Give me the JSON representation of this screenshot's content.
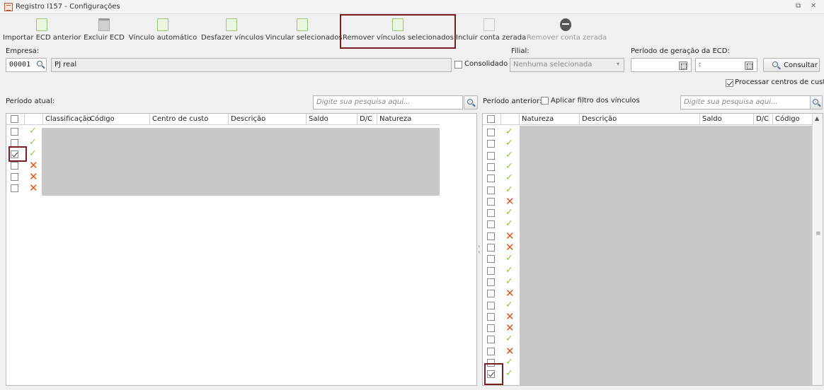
{
  "window": {
    "title": "Registro I157 - Configurações",
    "restore_glyph": "⧉",
    "close_glyph": "✕"
  },
  "toolbar": {
    "import_label": "Importar ECD anterior",
    "delete_label": "Excluir ECD",
    "auto_link_label": "Vínculo automático",
    "undo_links_label": "Desfazer vínculos",
    "link_selected_label": "Vincular selecionados",
    "remove_links_label": "Remover vínculos selecionados",
    "include_zero_label": "Incluir conta zerada",
    "remove_zero_label": "Remover conta zerada"
  },
  "filters": {
    "empresa_label": "Empresa:",
    "empresa_code": "00001",
    "empresa_name": "PJ real",
    "consolidado_label": "Consolidado",
    "filial_label": "Filial:",
    "filial_value": "Nenhuma selecionada",
    "periodo_label": "Período de geração da ECD:",
    "periodo_sep": ":",
    "consultar_label": "Consultar",
    "processar_label": "Processar centros de custo"
  },
  "left": {
    "title": "Período atual:",
    "search_placeholder": "Digite sua pesquisa aqui...",
    "columns": [
      "Classificação",
      "Código",
      "Centro de custo",
      "Descrição",
      "Saldo",
      "D/C",
      "Natureza"
    ],
    "rows": [
      "ok",
      "ok",
      "ok",
      "no",
      "no",
      "no"
    ],
    "checked_row": 2
  },
  "right": {
    "title": "Período anterior:",
    "filter_label": "Aplicar filtro dos vínculos",
    "search_placeholder": "Digite sua pesquisa aqui...",
    "columns": [
      "Natureza",
      "Descrição",
      "Saldo",
      "D/C",
      "Código"
    ],
    "rows": [
      "ok",
      "ok",
      "ok",
      "ok",
      "ok",
      "ok",
      "no",
      "ok",
      "ok",
      "no",
      "no",
      "ok",
      "ok",
      "ok",
      "no",
      "ok",
      "no",
      "no",
      "ok",
      "no",
      "ok",
      "ok"
    ]
  },
  "colors": {
    "accent_highlight": "#7a1f1f",
    "ok_green": "#8cc63e",
    "error_red": "#e0531f"
  }
}
